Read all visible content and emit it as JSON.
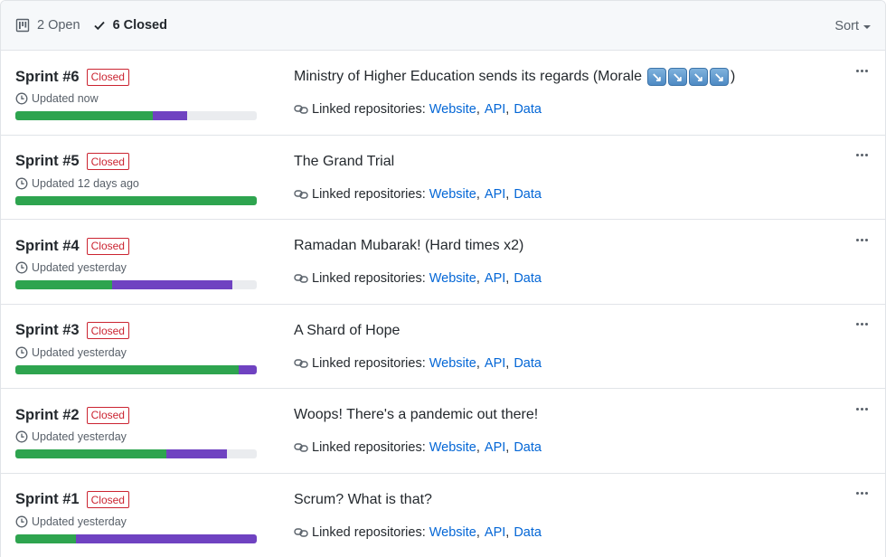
{
  "header": {
    "open_count": "2",
    "open_label": "Open",
    "closed_count": "6",
    "closed_label": "Closed",
    "sort_label": "Sort"
  },
  "repos_label": "Linked repositories:",
  "repos": [
    "Website",
    "API",
    "Data"
  ],
  "closed_badge": "Closed",
  "colors": {
    "done": "#2ea44f",
    "in_progress": "#6f42c1",
    "empty": "#eaecef",
    "closed": "#cb2431",
    "link": "#0366d6"
  },
  "milestones": [
    {
      "name": "Sprint #6",
      "updated": "Updated now",
      "description": "Ministry of Higher Education sends its regards (Morale",
      "description_suffix": ")",
      "morale_icons": [
        "arrow-down-right-emoji",
        "arrow-down-right-emoji",
        "arrow-down-right-emoji",
        "arrow-down-right-emoji"
      ],
      "progress_done_pct": 57,
      "progress_in_progress_pct": 14
    },
    {
      "name": "Sprint #5",
      "updated": "Updated 12 days ago",
      "description": "The Grand Trial",
      "progress_done_pct": 100,
      "progress_in_progress_pct": 0
    },
    {
      "name": "Sprint #4",
      "updated": "Updated yesterday",
      "description": "Ramadan Mubarak! (Hard times x2)",
      "progress_done_pct": 40,
      "progress_in_progress_pct": 50
    },
    {
      "name": "Sprint #3",
      "updated": "Updated yesterday",
      "description": "A Shard of Hope",
      "progress_done_pct": 92.5,
      "progress_in_progress_pct": 7.5
    },
    {
      "name": "Sprint #2",
      "updated": "Updated yesterday",
      "description": "Woops! There's a pandemic out there!",
      "progress_done_pct": 62.5,
      "progress_in_progress_pct": 25
    },
    {
      "name": "Sprint #1",
      "updated": "Updated yesterday",
      "description": "Scrum? What is that?",
      "progress_done_pct": 25,
      "progress_in_progress_pct": 75
    }
  ]
}
